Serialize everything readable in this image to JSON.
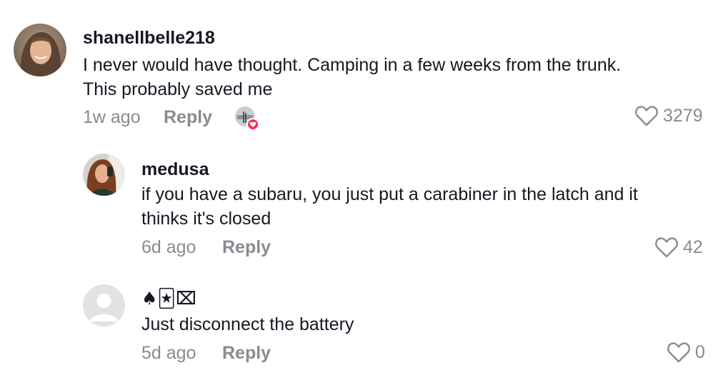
{
  "comments": [
    {
      "username": "shanellbelle218",
      "text_lines": [
        "I never would have thought. Camping in a few weeks from the trunk.",
        "This probably saved me"
      ],
      "time": "1w ago",
      "reply_label": "Reply",
      "likes": "3279",
      "liked_by_creator": true
    },
    {
      "username": "medusa",
      "text_lines": [
        "if you have a subaru, you just put a carabiner in the latch and it",
        "thinks it's closed"
      ],
      "time": "6d ago",
      "reply_label": "Reply",
      "likes": "42"
    },
    {
      "username": "♠🃏⌧",
      "text_lines": [
        "Just disconnect the battery"
      ],
      "time": "5d ago",
      "reply_label": "Reply",
      "likes": "0"
    }
  ],
  "colors": {
    "accent": "#fe2c55",
    "secondary_text": "#8a8b91",
    "primary_text": "#161823"
  },
  "icons": [
    "heart-outline-icon",
    "creator-liked-heart-icon",
    "default-avatar-icon"
  ]
}
